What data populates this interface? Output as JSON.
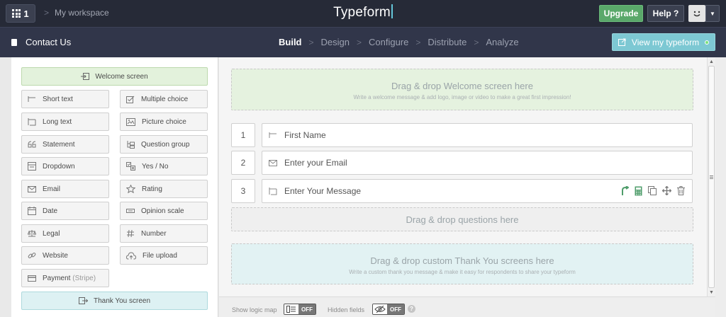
{
  "topbar": {
    "apps_count": "1",
    "breadcrumb_sep": ">",
    "workspace": "My workspace",
    "logo": "Typeform",
    "upgrade": "Upgrade",
    "help": "Help ?",
    "avatar_icon": "smiley-face-icon",
    "dropdown": "▼"
  },
  "navbar": {
    "form_title": "Contact Us",
    "steps": [
      "Build",
      "Design",
      "Configure",
      "Distribute",
      "Analyze"
    ],
    "active_step": "Build",
    "step_sep": ">",
    "view_button": "View my typeform"
  },
  "left_panel": {
    "welcome": "Welcome screen",
    "question_types": [
      {
        "label": "Short text",
        "icon": "short-text-icon"
      },
      {
        "label": "Multiple choice",
        "icon": "multiple-choice-icon"
      },
      {
        "label": "Long text",
        "icon": "long-text-icon"
      },
      {
        "label": "Picture choice",
        "icon": "picture-choice-icon"
      },
      {
        "label": "Statement",
        "icon": "quote-icon"
      },
      {
        "label": "Question group",
        "icon": "question-group-icon"
      },
      {
        "label": "Dropdown",
        "icon": "dropdown-icon"
      },
      {
        "label": "Yes / No",
        "icon": "yes-no-icon"
      },
      {
        "label": "Email",
        "icon": "email-icon"
      },
      {
        "label": "Rating",
        "icon": "star-icon"
      },
      {
        "label": "Date",
        "icon": "calendar-icon"
      },
      {
        "label": "Opinion scale",
        "icon": "opinion-scale-icon"
      },
      {
        "label": "Legal",
        "icon": "legal-icon"
      },
      {
        "label": "Number",
        "icon": "number-icon"
      },
      {
        "label": "Website",
        "icon": "link-icon"
      },
      {
        "label": "File upload",
        "icon": "cloud-upload-icon"
      }
    ],
    "payment": "Payment",
    "payment_provider": "(Stripe)",
    "thanks": "Thank You screen"
  },
  "main": {
    "welcome_drop_title": "Drag & drop Welcome screen here",
    "welcome_drop_sub": "Write a welcome message & add logo, image or video to make a great first impression!",
    "questions": [
      {
        "num": "1",
        "label": "First Name",
        "icon": "short-text-icon"
      },
      {
        "num": "2",
        "label": "Enter your Email",
        "icon": "email-icon"
      },
      {
        "num": "3",
        "label": "Enter Your Message",
        "icon": "long-text-icon"
      }
    ],
    "question_actions": [
      "logic-jump-icon",
      "calculator-icon",
      "duplicate-icon",
      "move-icon",
      "trash-icon"
    ],
    "question_drop": "Drag & drop questions here",
    "thanks_drop_title": "Drag & drop custom Thank You screens here",
    "thanks_drop_sub": "Write a custom thank you message & make it easy for respondents to share your typeform"
  },
  "footer": {
    "logic_map_label": "Show logic map",
    "logic_map_state": "OFF",
    "hidden_fields_label": "Hidden fields",
    "hidden_fields_state": "OFF",
    "help_mark": "?"
  },
  "colors": {
    "topbar_bg": "#262a37",
    "navbar_bg": "#31364a",
    "upgrade_green": "#5aa86a",
    "view_teal": "#7dc8d3",
    "welcome_green": "#e3f2dc",
    "thanks_blue": "#ddf1f3"
  }
}
